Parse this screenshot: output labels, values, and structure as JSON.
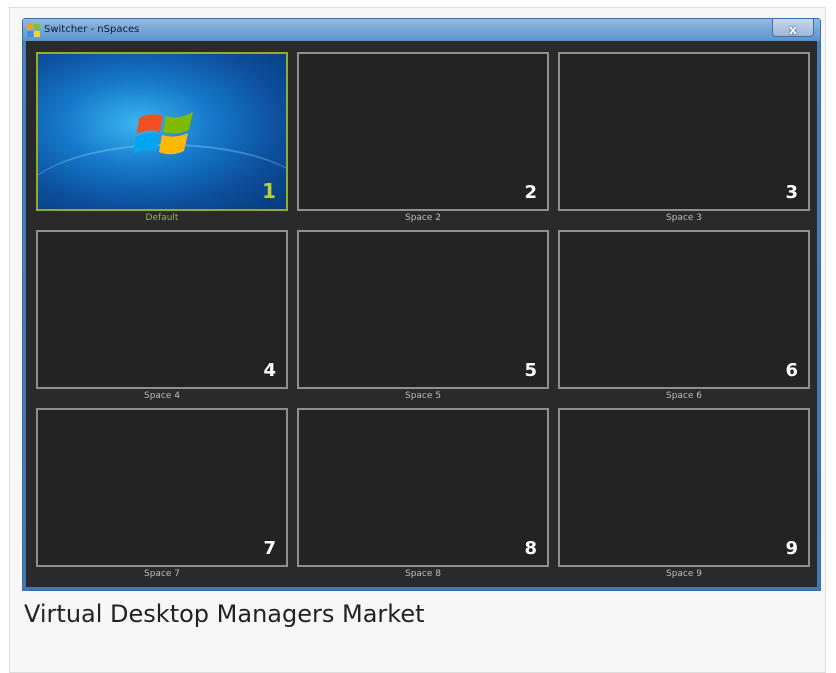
{
  "window": {
    "title": "Switcher - nSpaces",
    "close_glyph": "x",
    "icon": "nspaces-app-icon"
  },
  "spaces": [
    {
      "number": "1",
      "label": "Default",
      "active": true
    },
    {
      "number": "2",
      "label": "Space 2",
      "active": false
    },
    {
      "number": "3",
      "label": "Space 3",
      "active": false
    },
    {
      "number": "4",
      "label": "Space 4",
      "active": false
    },
    {
      "number": "5",
      "label": "Space 5",
      "active": false
    },
    {
      "number": "6",
      "label": "Space 6",
      "active": false
    },
    {
      "number": "7",
      "label": "Space 7",
      "active": false
    },
    {
      "number": "8",
      "label": "Space 8",
      "active": false
    },
    {
      "number": "9",
      "label": "Space 9",
      "active": false
    }
  ],
  "caption": "Virtual Desktop Managers Market",
  "colors": {
    "active_border": "#8fae2c",
    "active_number": "#b5d334",
    "tile_background": "#232323",
    "tile_border": "#8f8f8f",
    "window_frame": "#3f78b5"
  }
}
